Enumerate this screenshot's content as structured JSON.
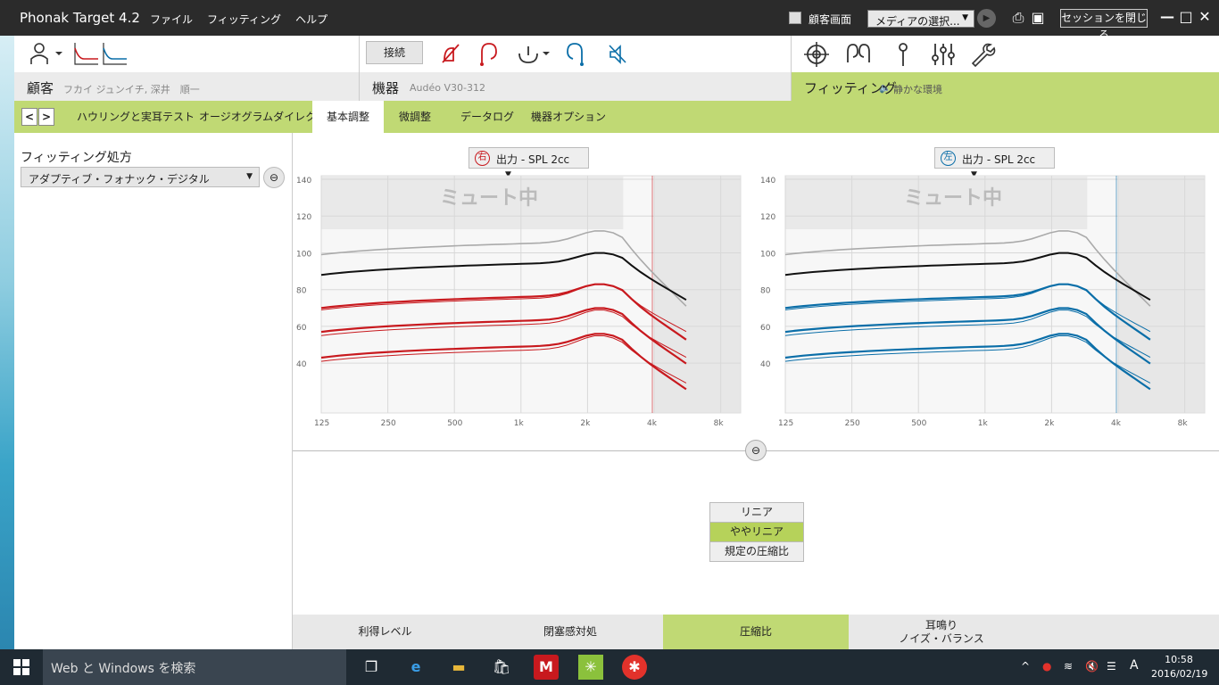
{
  "titlebar": {
    "app_title": "Phonak Target 4.2",
    "menu": [
      "ファイル",
      "フィッティング",
      "ヘルプ"
    ],
    "client_screen_label": "顧客画面",
    "media_select": "メディアの選択...",
    "close_session": "セッションを閉じる"
  },
  "sections": {
    "client": {
      "label": "顧客",
      "value": "フカイ ジュンイチ, 深井　順一"
    },
    "device": {
      "label": "機器",
      "value": "Audéo V30-312",
      "connect": "接続"
    },
    "fitting": {
      "label": "フィッティング",
      "value": "静かな環境"
    }
  },
  "tabs": [
    "ハウリングと実耳テスト",
    "オージオグラムダイレクト",
    "基本調整",
    "微調整",
    "データログ",
    "機器オプション"
  ],
  "active_tab": "基本調整",
  "left_panel": {
    "title": "フィッティング処方",
    "formula": "アダプティブ・フォナック・デジタル"
  },
  "graphs": [
    {
      "side": "右",
      "selector": "出力 - SPL 2cc",
      "overlay": "ミュート中",
      "accent": "#c8191e"
    },
    {
      "side": "左",
      "selector": "出力 - SPL 2cc",
      "overlay": "ミュート中",
      "accent": "#0a6ea8"
    }
  ],
  "axis": {
    "y_ticks": [
      "140",
      "120",
      "100",
      "80",
      "60",
      "40"
    ],
    "x_ticks": [
      "125",
      "250",
      "500",
      "1k",
      "2k",
      "4k",
      "8k"
    ]
  },
  "compression_options": [
    "リニア",
    "ややリニア",
    "規定の圧縮比"
  ],
  "compression_selected": "ややリニア",
  "bottom_tabs": [
    "利得レベル",
    "閉塞感対処",
    "圧縮比",
    "耳鳴り\nノイズ・バランス"
  ],
  "bottom_active": "圧縮比",
  "taskbar": {
    "search_placeholder": "Web と Windows を検索",
    "ime": "A",
    "time": "10:58",
    "date": "2016/02/19"
  },
  "colors": {
    "accent_green": "#c0d974",
    "right_ear": "#c8191e",
    "left_ear": "#0a6ea8"
  }
}
